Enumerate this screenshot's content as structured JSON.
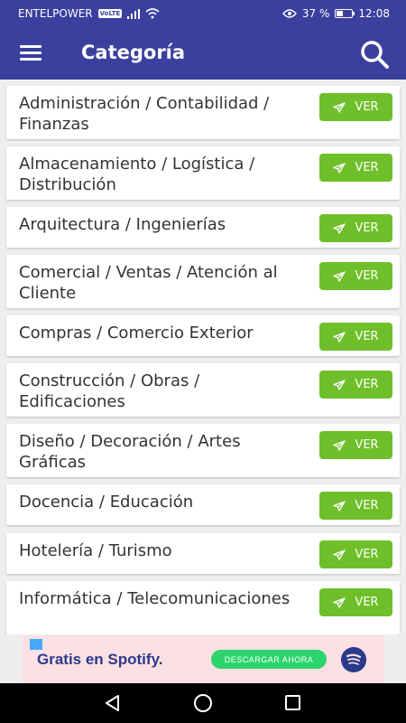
{
  "status": {
    "carrier": "ENTELPOWER",
    "volte": "VoLTE",
    "battery": "37 %",
    "battery_level": 0.37,
    "time": "12:08"
  },
  "appbar": {
    "title": "Categoría"
  },
  "button_label": "VER",
  "categories": [
    "Administración / Contabilidad / Finanzas",
    "Almacenamiento / Logística / Distribución",
    "Arquitectura / Ingenierías",
    "Comercial / Ventas / Atención al Cliente",
    "Compras / Comercio Exterior",
    "Construcción / Obras / Edificaciones",
    "Diseño / Decoración / Artes Gráficas",
    "Docencia / Educación",
    "Hotelería / Turismo",
    "Informática / Telecomunicaciones"
  ],
  "ad": {
    "title": "Gratis en Spotify.",
    "cta": "DESCARGAR AHORA"
  },
  "colors": {
    "primary": "#3b3f9e",
    "button": "#6fbf2a",
    "ad_bg": "#fde0e4",
    "ad_cta": "#2bd56b"
  }
}
